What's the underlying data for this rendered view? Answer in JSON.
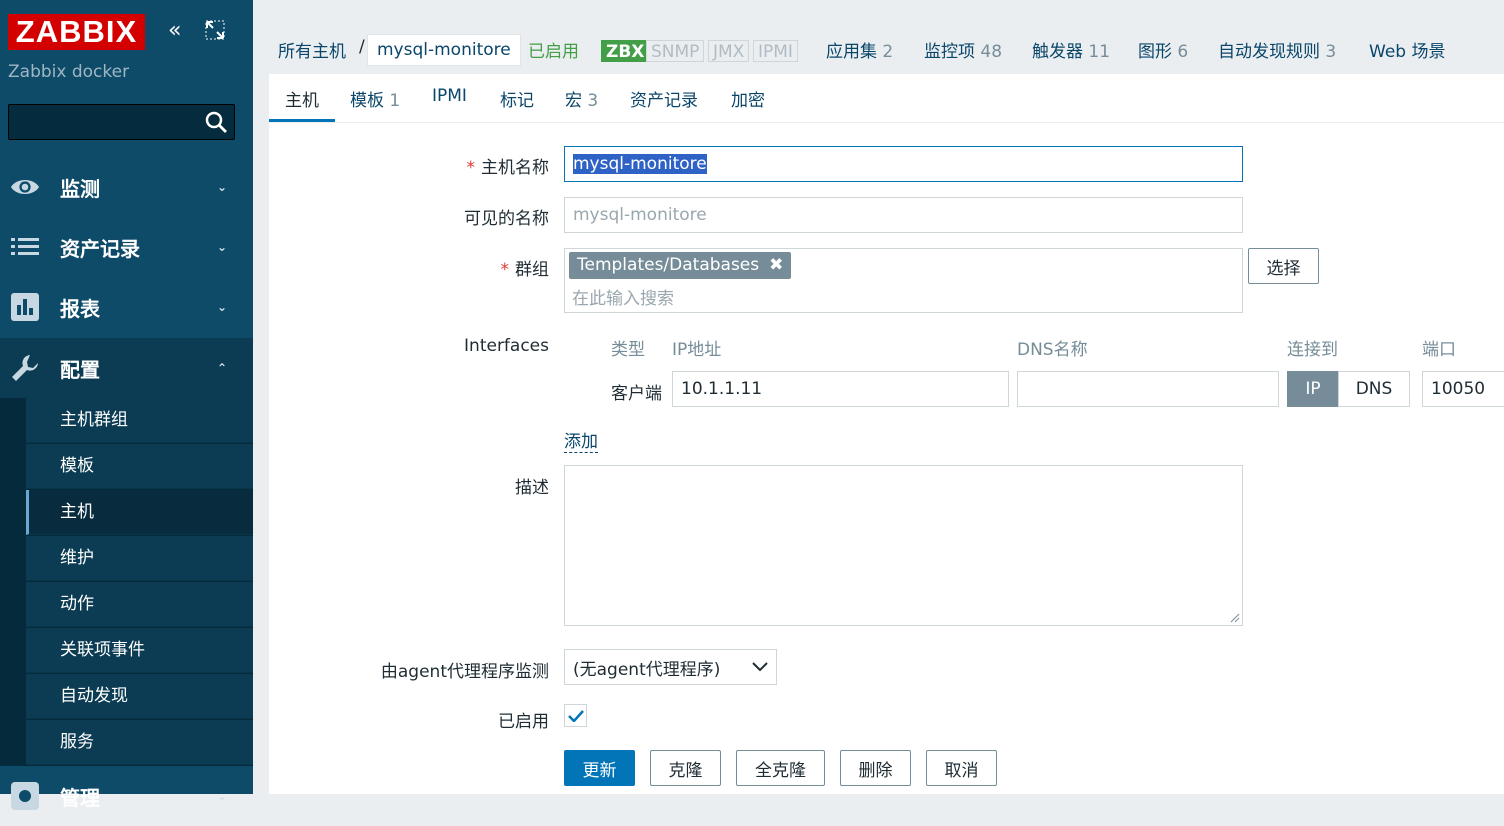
{
  "sidebar": {
    "logo": "ZABBIX",
    "subtitle": "Zabbix docker",
    "collapse_glyph": "«",
    "menu": [
      {
        "label": "监测",
        "icon": "eye-icon"
      },
      {
        "label": "资产记录",
        "icon": "list-icon"
      },
      {
        "label": "报表",
        "icon": "bar-chart-icon"
      },
      {
        "label": "配置",
        "icon": "wrench-icon"
      },
      {
        "label": "管理",
        "icon": "gear-icon"
      }
    ],
    "submenu": [
      "主机群组",
      "模板",
      "主机",
      "维护",
      "动作",
      "关联项事件",
      "自动发现",
      "服务"
    ]
  },
  "header": {
    "all_hosts": "所有主机",
    "separator": "/",
    "host": "mysql-monitore",
    "status": "已启用",
    "availability": [
      "ZBX",
      "SNMP",
      "JMX",
      "IPMI"
    ],
    "links": [
      {
        "label": "应用集",
        "count": "2"
      },
      {
        "label": "监控项",
        "count": "48"
      },
      {
        "label": "触发器",
        "count": "11"
      },
      {
        "label": "图形",
        "count": "6"
      },
      {
        "label": "自动发现规则",
        "count": "3"
      },
      {
        "label": "Web 场景",
        "count": ""
      }
    ]
  },
  "tabs": [
    {
      "label": "主机",
      "count": ""
    },
    {
      "label": "模板",
      "count": "1"
    },
    {
      "label": "IPMI",
      "count": ""
    },
    {
      "label": "标记",
      "count": ""
    },
    {
      "label": "宏",
      "count": "3"
    },
    {
      "label": "资产记录",
      "count": ""
    },
    {
      "label": "加密",
      "count": ""
    }
  ],
  "form": {
    "required_mark": "*",
    "hostname_label": "主机名称",
    "hostname_value": "mysql-monitore",
    "visible_label": "可见的名称",
    "visible_placeholder": "mysql-monitore",
    "groups_label": "群组",
    "group_tag": "Templates/Databases",
    "group_remove": "✖",
    "group_search_placeholder": "在此输入搜索",
    "select_button": "选择",
    "interfaces_label": "Interfaces",
    "iface_headers": {
      "type": "类型",
      "ip": "IP地址",
      "dns": "DNS名称",
      "connect": "连接到",
      "port": "端口"
    },
    "iface_row": {
      "type": "客户端",
      "ip": "10.1.1.11",
      "dns": "",
      "connect_ip": "IP",
      "connect_dns": "DNS",
      "port": "10050"
    },
    "add_link": "添加",
    "description_label": "描述",
    "description_value": "",
    "proxy_label": "由agent代理程序监测",
    "proxy_value": "(无agent代理程序)",
    "enabled_label": "已启用",
    "enabled": true
  },
  "buttons": [
    "更新",
    "克隆",
    "全克隆",
    "删除",
    "取消"
  ]
}
